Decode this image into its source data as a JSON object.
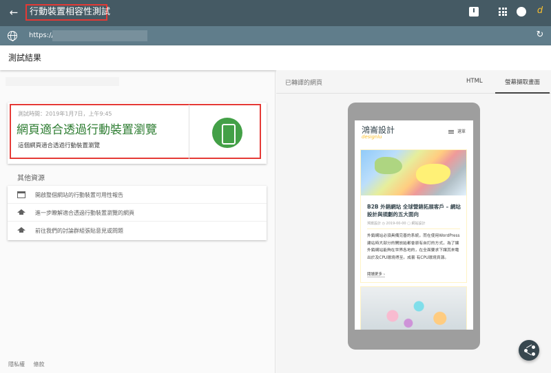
{
  "app": {
    "title": "行動裝置相容性測試",
    "back_icon": "arrow-back-icon",
    "feedback_icon": "feedback-icon",
    "apps_icon": "apps-grid-icon",
    "account_icon": "account-icon",
    "logo_glyph": "d"
  },
  "urlbar": {
    "url": "https://"
  },
  "results": {
    "title": "測試結果",
    "test_time": "測試時間：2019年1月7日，上午9:45",
    "verdict": "網頁適合透過行動裝置瀏覽",
    "verdict_sub": "這個網頁適合透過行動裝置瀏覽",
    "accent_color": "#2e7d32",
    "highlight_color": "#e53935"
  },
  "other_resources": {
    "title": "其他資源",
    "items": [
      {
        "icon": "browser-window-icon",
        "label": "開啟整個網站的行動裝置可用性報告"
      },
      {
        "icon": "graduation-cap-icon",
        "label": "進一步瞭解適合透過行動裝置瀏覽的網頁"
      },
      {
        "icon": "graduation-cap-icon",
        "label": "前往我們的討論群組張貼意見或問題"
      }
    ]
  },
  "footer": {
    "privacy": "隱私權",
    "terms": "條款"
  },
  "preview": {
    "label": "已轉譯的網頁",
    "tabs": [
      "HTML",
      "螢幕擷取畫面"
    ],
    "active_tab": "螢幕擷取畫面",
    "site_logo": "鴻崙設計",
    "site_logo_sub": "designlu",
    "menu_label": "選單",
    "post_title": "B2B 外銷網站 全球營銷拓展客戶 – 網站設計與規劃的五大面向",
    "post_meta": "鴻崙設計 ◷ 2019-00-00 ▢ 網站設計",
    "post_excerpt": "外銷網站必須具備完善的系統，而在使用WordPress 建站時大部分的開放給都會原有自訂的方式，為了讓外銷網站能夠在世界各地的，在全面要求下讓其來電出於及CPU環境得至。成套 有CPU環境資源。",
    "read_more": "閱讀更多 ›"
  },
  "share_icon": "share-icon"
}
